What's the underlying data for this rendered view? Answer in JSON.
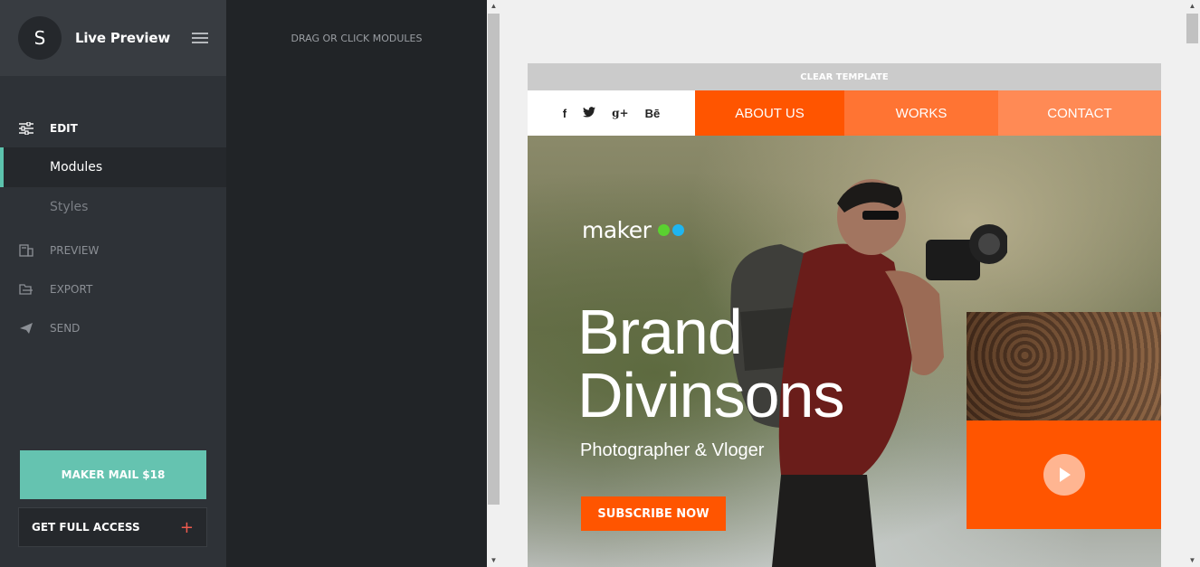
{
  "sidebar": {
    "avatar_letter": "S",
    "title": "Live Preview",
    "edit_label": "EDIT",
    "sub_items": [
      {
        "label": "Modules"
      },
      {
        "label": "Styles"
      }
    ],
    "nav_items": [
      {
        "label": "PREVIEW",
        "icon": "preview-icon"
      },
      {
        "label": "EXPORT",
        "icon": "export-icon"
      },
      {
        "label": "SEND",
        "icon": "send-icon"
      }
    ],
    "maker_mail_label": "MAKER MAIL $18",
    "full_access_label": "GET FULL ACCESS",
    "full_access_icon": "+"
  },
  "modules_panel": {
    "heading": "DRAG OR CLICK MODULES"
  },
  "template": {
    "clear_label": "CLEAR TEMPLATE",
    "social": [
      {
        "icon": "facebook-icon",
        "glyph": "f"
      },
      {
        "icon": "twitter-icon",
        "glyph": "🐦"
      },
      {
        "icon": "google-plus-icon",
        "glyph": "g+"
      },
      {
        "icon": "behance-icon",
        "glyph": "Bē"
      }
    ],
    "nav": [
      "ABOUT US",
      "WORKS",
      "CONTACT"
    ],
    "logo_text": "maker",
    "headline_line1": "Brand",
    "headline_line2": "Divinsons",
    "subheadline": "Photographer & Vloger",
    "subscribe_label": "SUBSCRIBE NOW"
  },
  "colors": {
    "accent_teal": "#65c3b0",
    "accent_orange": "#ff5500",
    "logo_dot_green": "#5ad130",
    "logo_dot_blue": "#1fb5f0"
  }
}
